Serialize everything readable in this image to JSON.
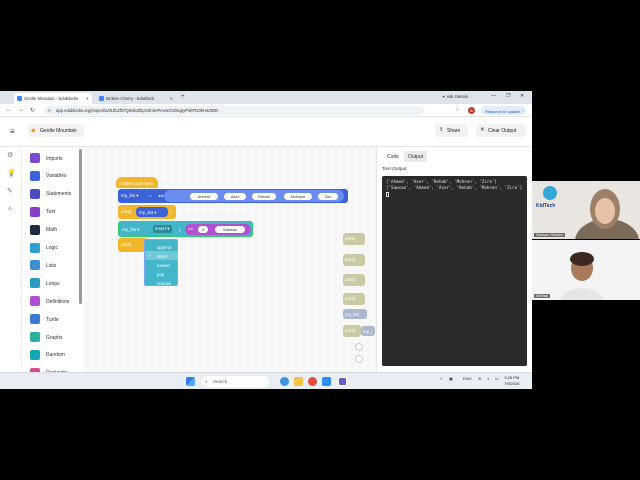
{
  "browser": {
    "tabs": [
      {
        "title": "Gentle Mountain - EduBlocks",
        "active": true
      },
      {
        "title": "Broken Cherry - EduBlock",
        "active": false
      }
    ],
    "new_tab": "+",
    "ask_gemini": "Ask Gemini",
    "url": "app.edublocks.org/project/a/3UfcZfk7Q5ck0ZfqJmfr4mPmvtnO3/5qpyPshPD09H4Z60K",
    "relaunch": "Relaunch to update",
    "profile_initial": "A",
    "window_controls": [
      "—",
      "❐",
      "✕"
    ]
  },
  "app": {
    "project_name": "Gentle Mountain",
    "share_label": "Share",
    "clear_output_label": "Clear Output",
    "categories": [
      {
        "label": "Imports",
        "color": "#7a4bcf"
      },
      {
        "label": "Variables",
        "color": "#3b62d6"
      },
      {
        "label": "Statements",
        "color": "#4a4bbf"
      },
      {
        "label": "Text",
        "color": "#8a3fc9"
      },
      {
        "label": "Math",
        "color": "#1e2a3f"
      },
      {
        "label": "Logic",
        "color": "#2fa0d4"
      },
      {
        "label": "Lists",
        "color": "#3d8fd6"
      },
      {
        "label": "Loops",
        "color": "#2a9bc5"
      },
      {
        "label": "Definitions",
        "color": "#b34fd1"
      },
      {
        "label": "Turtle",
        "color": "#3d7ad6"
      },
      {
        "label": "Graphs",
        "color": "#2cb0a0"
      },
      {
        "label": "Random",
        "color": "#17a5b5"
      },
      {
        "label": "Requests",
        "color": "#d94f8a"
      }
    ]
  },
  "workspace": {
    "start_block": "# Start code here",
    "var1": "my_list",
    "equals": "=",
    "list_items": [
      "Ahmed",
      "Aser",
      "Rehab",
      "Mohsen",
      "Ziro"
    ],
    "print1": "print(",
    "print1_arg": "my_list",
    "print1_close": ")",
    "method_var": "my_list",
    "method_dot": ".",
    "method_name": "insert",
    "method_open": "(",
    "index_value": "0",
    "insert_value": "Sawsan",
    "method_close": ")",
    "print2": "print(",
    "dropdown_options": [
      "append",
      "insert",
      "extend",
      "pop",
      "remove"
    ],
    "dropdown_selected": "insert",
    "side_blocks": [
      "print(",
      "print(",
      "print(",
      "print(",
      "my_list",
      "print("
    ],
    "side_blocks_extra": [
      "my_l"
    ]
  },
  "output": {
    "tabs": [
      "Code",
      "Output"
    ],
    "active_tab": "Output",
    "title": "Text Output",
    "lines": [
      "['Ahmed', 'Aser', 'Rehab', 'Mohsen', 'Ziro']",
      "['Sawsan', 'Ahmed', 'Aser', 'Rehab', 'Mohsen', 'Ziro']"
    ]
  },
  "taskbar": {
    "search_placeholder": "Search",
    "lang": "ENG",
    "time": "3:26 PM",
    "date": "7/9/2026"
  },
  "video": {
    "participant1": "Sawsan Hisham",
    "participant2": "Ahmad",
    "logo_text": "KidTech"
  }
}
